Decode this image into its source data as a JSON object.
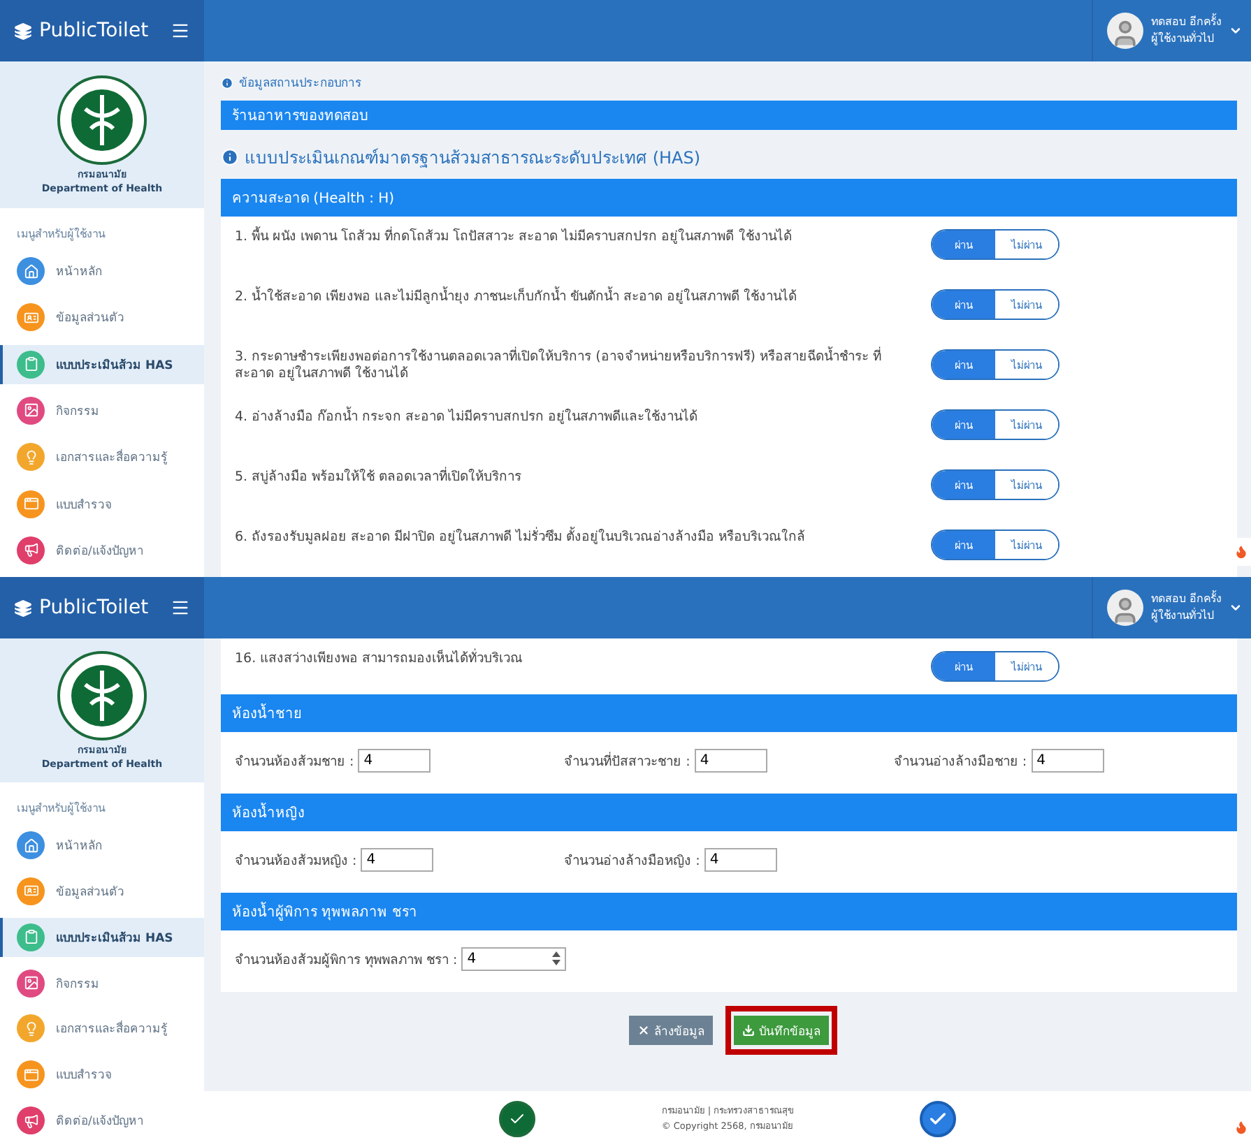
{
  "screens": [
    {
      "header": {
        "brand": "PublicToilet",
        "user_name": "ทดสอบ อีกครั้ง",
        "user_role": "ผู้ใช้งานทั่วไป"
      },
      "sidebar": {
        "logo_th": "กรมอนามัย",
        "logo_en": "Department of Health",
        "menu_title": "เมนูสำหรับผู้ใช้งาน",
        "items": [
          {
            "label": "หน้าหลัก",
            "color": "#3d8fe0",
            "selected": false
          },
          {
            "label": "ข้อมูลส่วนตัว",
            "color": "#f7941d",
            "selected": false
          },
          {
            "label": "แบบประเมินส้วม HAS",
            "color": "#3dbd8b",
            "selected": true
          },
          {
            "label": "กิจกรรม",
            "color": "#e04a80",
            "selected": false
          },
          {
            "label": "เอกสารและสื่อความรู้",
            "color": "#f2a72c",
            "selected": false
          },
          {
            "label": "แบบสำรวจ",
            "color": "#f7941d",
            "selected": false
          },
          {
            "label": "ติดต่อ/แจ้งปัญหา",
            "color": "#e03e6b",
            "selected": false
          }
        ]
      },
      "content": [
        {
          "kind": "note",
          "text": "ข้อมูลสถานประกอบการ"
        },
        {
          "kind": "bar",
          "text": "ร้านอาหารของทดสอบ"
        },
        {
          "kind": "heading",
          "text": "แบบประเมินเกณฑ์มาตรฐานส้วมสาธารณะระดับประเทศ (HAS)"
        },
        {
          "kind": "criteria",
          "title": "ความสะอาด (Health : H)",
          "items": [
            {
              "text": "1. พื้น ผนัง เพดาน โถส้วม ที่กดโถส้วม โถปัสสาวะ สะอาด ไม่มีคราบสกปรก อยู่ในสภาพดี ใช้งานได้",
              "options": [
                {
                  "label": "ผ่าน",
                  "selected": true
                },
                {
                  "label": "ไม่ผ่าน",
                  "selected": false
                }
              ]
            },
            {
              "text": "2. น้ำใช้สะอาด เพียงพอ และไม่มีลูกน้ำยุง ภาชนะเก็บกักน้ำ ขันตักน้ำ สะอาด อยู่ในสภาพดี ใช้งานได้",
              "options": [
                {
                  "label": "ผ่าน",
                  "selected": true
                },
                {
                  "label": "ไม่ผ่าน",
                  "selected": false
                }
              ]
            },
            {
              "text": "3. กระดาษชำระเพียงพอต่อการใช้งานตลอดเวลาที่เปิดให้บริการ (อาจจำหน่ายหรือบริการฟรี) หรือสายฉีดน้ำชำระ ที่สะอาด อยู่ในสภาพดี ใช้งานได้",
              "options": [
                {
                  "label": "ผ่าน",
                  "selected": true
                },
                {
                  "label": "ไม่ผ่าน",
                  "selected": false
                }
              ]
            },
            {
              "text": "4. อ่างล้างมือ ก๊อกน้ำ กระจก สะอาด ไม่มีคราบสกปรก อยู่ในสภาพดีและใช้งานได้",
              "options": [
                {
                  "label": "ผ่าน",
                  "selected": true
                },
                {
                  "label": "ไม่ผ่าน",
                  "selected": false
                }
              ]
            },
            {
              "text": "5. สบู่ล้างมือ พร้อมให้ใช้ ตลอดเวลาที่เปิดให้บริการ",
              "options": [
                {
                  "label": "ผ่าน",
                  "selected": true
                },
                {
                  "label": "ไม่ผ่าน",
                  "selected": false
                }
              ]
            },
            {
              "text": "6. ถังรองรับมูลฝอย สะอาด มีฝาปิด อยู่ในสภาพดี ไม่รั่วซึม ตั้งอยู่ในบริเวณอ่างล้างมือ หรือบริเวณใกล้",
              "options": [
                {
                  "label": "ผ่าน",
                  "selected": true
                },
                {
                  "label": "ไม่ผ่าน",
                  "selected": false
                }
              ]
            }
          ]
        }
      ]
    },
    {
      "header": {
        "brand": "PublicToilet",
        "user_name": "ทดสอบ อีกครั้ง",
        "user_role": "ผู้ใช้งานทั่วไป"
      },
      "sidebar": {
        "logo_th": "กรมอนามัย",
        "logo_en": "Department of Health",
        "menu_title": "เมนูสำหรับผู้ใช้งาน",
        "items": [
          {
            "label": "หน้าหลัก",
            "color": "#3d8fe0",
            "selected": false
          },
          {
            "label": "ข้อมูลส่วนตัว",
            "color": "#f7941d",
            "selected": false
          },
          {
            "label": "แบบประเมินส้วม HAS",
            "color": "#3dbd8b",
            "selected": true
          },
          {
            "label": "กิจกรรม",
            "color": "#e04a80",
            "selected": false
          },
          {
            "label": "เอกสารและสื่อความรู้",
            "color": "#f2a72c",
            "selected": false
          },
          {
            "label": "แบบสำรวจ",
            "color": "#f7941d",
            "selected": false
          },
          {
            "label": "ติดต่อ/แจ้งปัญหา",
            "color": "#e03e6b",
            "selected": false
          }
        ]
      },
      "content": [
        {
          "kind": "criteria",
          "items": [
            {
              "text": "16. แสงสว่างเพียงพอ สามารถมองเห็นได้ทั่วบริเวณ",
              "options": [
                {
                  "label": "ผ่าน",
                  "selected": true
                },
                {
                  "label": "ไม่ผ่าน",
                  "selected": false
                }
              ]
            }
          ]
        },
        {
          "kind": "fields",
          "title": "ห้องน้ำชาย",
          "fields": [
            {
              "label": "จำนวนห้องส้วมชาย :",
              "value": "4",
              "kind": "text"
            },
            {
              "label": "จำนวนที่ปัสสาวะชาย :",
              "value": "4",
              "kind": "text"
            },
            {
              "label": "จำนวนอ่างล้างมือชาย :",
              "value": "4",
              "kind": "text"
            }
          ]
        },
        {
          "kind": "fields",
          "title": "ห้องน้ำหญิง",
          "fields": [
            {
              "label": "จำนวนห้องส้วมหญิง :",
              "value": "4",
              "kind": "text"
            },
            {
              "label": "จำนวนอ่างล้างมือหญิง :",
              "value": "4",
              "kind": "text"
            }
          ]
        },
        {
          "kind": "fields",
          "title": "ห้องน้ำผู้พิการ ทุพพลภาพ ชรา",
          "fields": [
            {
              "label": "จำนวนห้องส้วมผู้พิการ ทุพพลภาพ ชรา :",
              "value": "4",
              "kind": "number"
            }
          ]
        },
        {
          "kind": "actions",
          "buttons": [
            {
              "label": "ล้างข้อมูล",
              "kind": "clear",
              "highlighted": false
            },
            {
              "label": "บันทึกข้อมูล",
              "kind": "save",
              "highlighted": true
            }
          ]
        }
      ],
      "footer": {
        "lines": [
          "กรมอนามัย | กระทรวงสาธารณสุข",
          "© Copyright 2568, กรมอนามัย"
        ]
      }
    }
  ]
}
